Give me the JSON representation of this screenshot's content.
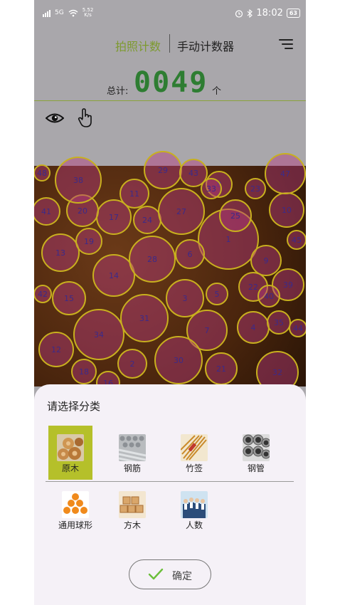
{
  "status_bar": {
    "network": "5G",
    "speed_value": "5.52",
    "speed_unit": "K/s",
    "time": "18:02",
    "battery": "63"
  },
  "header": {
    "tab_photo": "拍照计数",
    "tab_manual": "手动计数器"
  },
  "total": {
    "label": "总计:",
    "value": "0049",
    "unit": "个"
  },
  "circle_labels": [
    "1",
    "2",
    "3",
    "4",
    "5",
    "6",
    "7",
    "8",
    "9",
    "10",
    "11",
    "12",
    "13",
    "14",
    "15",
    "16",
    "17",
    "18",
    "19",
    "20",
    "21",
    "22",
    "23",
    "24",
    "25",
    "26",
    "27",
    "28",
    "29",
    "30",
    "31",
    "32",
    "33",
    "34",
    "35",
    "36",
    "37",
    "38",
    "39",
    "40",
    "41",
    "42",
    "43",
    "44",
    "45",
    "46",
    "47",
    "48",
    "49"
  ],
  "sheet": {
    "title": "请选择分类",
    "categories": [
      {
        "label": "原木",
        "selected": true
      },
      {
        "label": "钢筋",
        "selected": false
      },
      {
        "label": "竹签",
        "selected": false
      },
      {
        "label": "钢管",
        "selected": false
      },
      {
        "label": "通用球形",
        "selected": false
      },
      {
        "label": "方木",
        "selected": false
      },
      {
        "label": "人数",
        "selected": false
      }
    ],
    "confirm_label": "确定"
  },
  "colors": {
    "accent_green": "#7d9a2f",
    "counter_green": "#2e7d32",
    "circle_stroke": "#c8b01e",
    "circle_fill": "#b33a7d",
    "selected_bg": "#b5c02a"
  },
  "icons": [
    "eye-icon",
    "hand-pointer-icon",
    "menu-icon",
    "check-icon",
    "signal-icon",
    "wifi-icon",
    "alarm-icon",
    "bluetooth-icon",
    "battery-icon"
  ]
}
